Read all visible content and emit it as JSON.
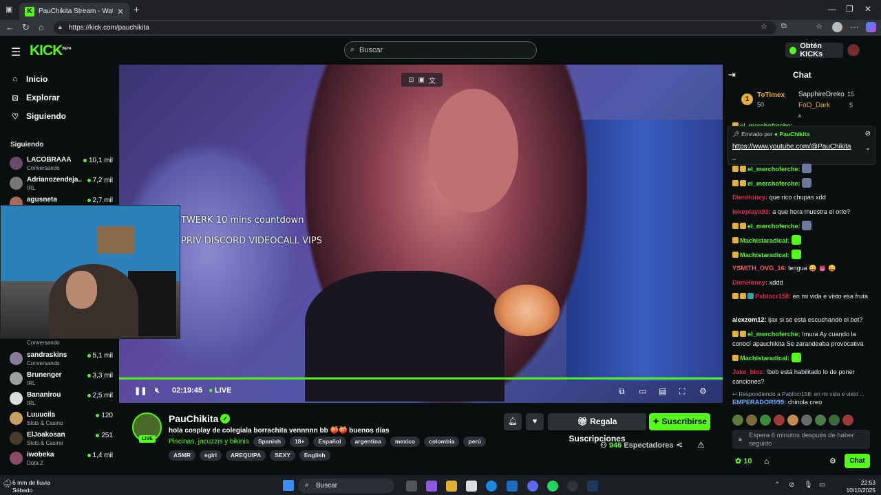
{
  "browser": {
    "tab_title": "PauChikita Stream - Watch Live o...",
    "url": "https://kick.com/pauchikita"
  },
  "header": {
    "logo": "KICK",
    "logo_badge": "BETA",
    "search_placeholder": "Buscar",
    "obten_label": "Obtén KICKs"
  },
  "sidebar": {
    "nav": [
      {
        "label": "Inicio",
        "icon": "home-icon"
      },
      {
        "label": "Explorar",
        "icon": "compass-icon"
      },
      {
        "label": "Siguiendo",
        "icon": "heart-icon"
      }
    ],
    "section_title": "Siguiendo",
    "following": [
      {
        "name": "LACOBRAAA",
        "category": "Conversando",
        "viewers": "10,1 mil"
      },
      {
        "name": "Adrianozendeja...",
        "category": "IRL",
        "viewers": "7,2 mil"
      },
      {
        "name": "agusneta",
        "category": "",
        "viewers": "2,7 mil"
      },
      {
        "name": "",
        "category": "Conversando",
        "viewers": ""
      },
      {
        "name": "sandraskins",
        "category": "Conversando",
        "viewers": "5,1 mil"
      },
      {
        "name": "Brunenger",
        "category": "IRL",
        "viewers": "3,3 mil"
      },
      {
        "name": "Bananirou",
        "category": "IRL",
        "viewers": "2,5 mil"
      },
      {
        "name": "Luuucila",
        "category": "Slots & Casino",
        "viewers": "120"
      },
      {
        "name": "ElJoakosan",
        "category": "Slots & Casino",
        "viewers": "251"
      },
      {
        "name": "iwobeka",
        "category": "Dota 2",
        "viewers": "1,4 mil"
      }
    ]
  },
  "video": {
    "overlay_line1": "TWERK 10 mins countdown",
    "overlay_line2": "PRIV DISCORD VIDEOCALL VIPS",
    "time": "02:19:45",
    "live_label": "LIVE",
    "progress": 1.0
  },
  "stream": {
    "streamer": "PauChikita",
    "live_badge": "LIVE",
    "title": "hola cosplay de colegiala borrachita vennnnn bb 🍑🍑 buenos días",
    "category": "Piscinas, jacuzzis y bikinis",
    "tags_row1": [
      "Spanish",
      "18+",
      "Español",
      "argentina",
      "mexico",
      "colombia",
      "perú"
    ],
    "tags_row2": [
      "ASMR",
      "egirl",
      "AREQUIPA",
      "SEXY",
      "English"
    ],
    "gift_label": "Regala Suscripciones",
    "subscribe_label": "Suscribirse",
    "viewers_count": "946",
    "viewers_label": "Espectadores"
  },
  "chat": {
    "title": "Chat",
    "leaderboard": [
      {
        "name": "ToTimex",
        "value": "50"
      },
      {
        "name": "SapphireDreko",
        "value": "15"
      },
      {
        "name": "FoO_Dark",
        "value": "5"
      }
    ],
    "rank": "1",
    "pinned_by_label": "Enviado por",
    "pinned_by": "PauChikita",
    "pinned_link": "https://www.youtube.com/@PauChikita",
    "pinned_extra": "_",
    "messages": [
      {
        "user": "el_merchoferche:",
        "text": "",
        "color": "#53fc18"
      },
      {
        "user": "el_merchoferche:",
        "text": "",
        "color": "#53fc18"
      },
      {
        "user": "DienHoney:",
        "text": "que rico chupas xdd",
        "color": "#e0264a"
      },
      {
        "user": "lokoplaya93:",
        "text": "a que hora muestra el orto?",
        "color": "#e0264a"
      },
      {
        "user": "el_merchoferche:",
        "text": "",
        "color": "#53fc18"
      },
      {
        "user": "Machistaradical:",
        "text": "",
        "color": "#53fc18"
      },
      {
        "user": "Machistaradical:",
        "text": "",
        "color": "#53fc18"
      },
      {
        "user": "YSMITH_OVG_16:",
        "text": "lengua 😛 👅 😛",
        "color": "#ff5a5a"
      },
      {
        "user": "DienHoney:",
        "text": "xddd",
        "color": "#e0264a"
      },
      {
        "user": "Pablocr158:",
        "text": "en mi vida e visto esa fruta",
        "color": "#e0264a"
      },
      {
        "user": "alexzom12:",
        "text": "ljax si se está escuchando el bot?",
        "color": "#ffffff"
      },
      {
        "user": "el_merchoferche:",
        "text": "!mura Ay cuando la conocí apauchikita Se zarandeaba provocativa",
        "color": "#53fc18"
      },
      {
        "user": "Machistaradical:",
        "text": "",
        "color": "#53fc18"
      },
      {
        "user": "Jake_bloz:",
        "text": "!bob está habilitado lo de poner canciones?",
        "color": "#e0264a"
      }
    ],
    "reply_to": "Respondiendo a Pablocr158: en mi vida e visto ...",
    "last_user": "EMPERADOR999:",
    "last_text": "chinola creo",
    "input_placeholder": "Espera 6 minutos después de haber seguido",
    "points": "10",
    "send_label": "Chat"
  },
  "taskbar": {
    "weather_line1": "6 mm de lluvia",
    "weather_line2": "Sábado",
    "search_label": "Buscar",
    "time": "22:53",
    "date": "10/10/2025"
  },
  "colors": {
    "accent": "#53fc18",
    "bg": "#0b0e0f"
  }
}
